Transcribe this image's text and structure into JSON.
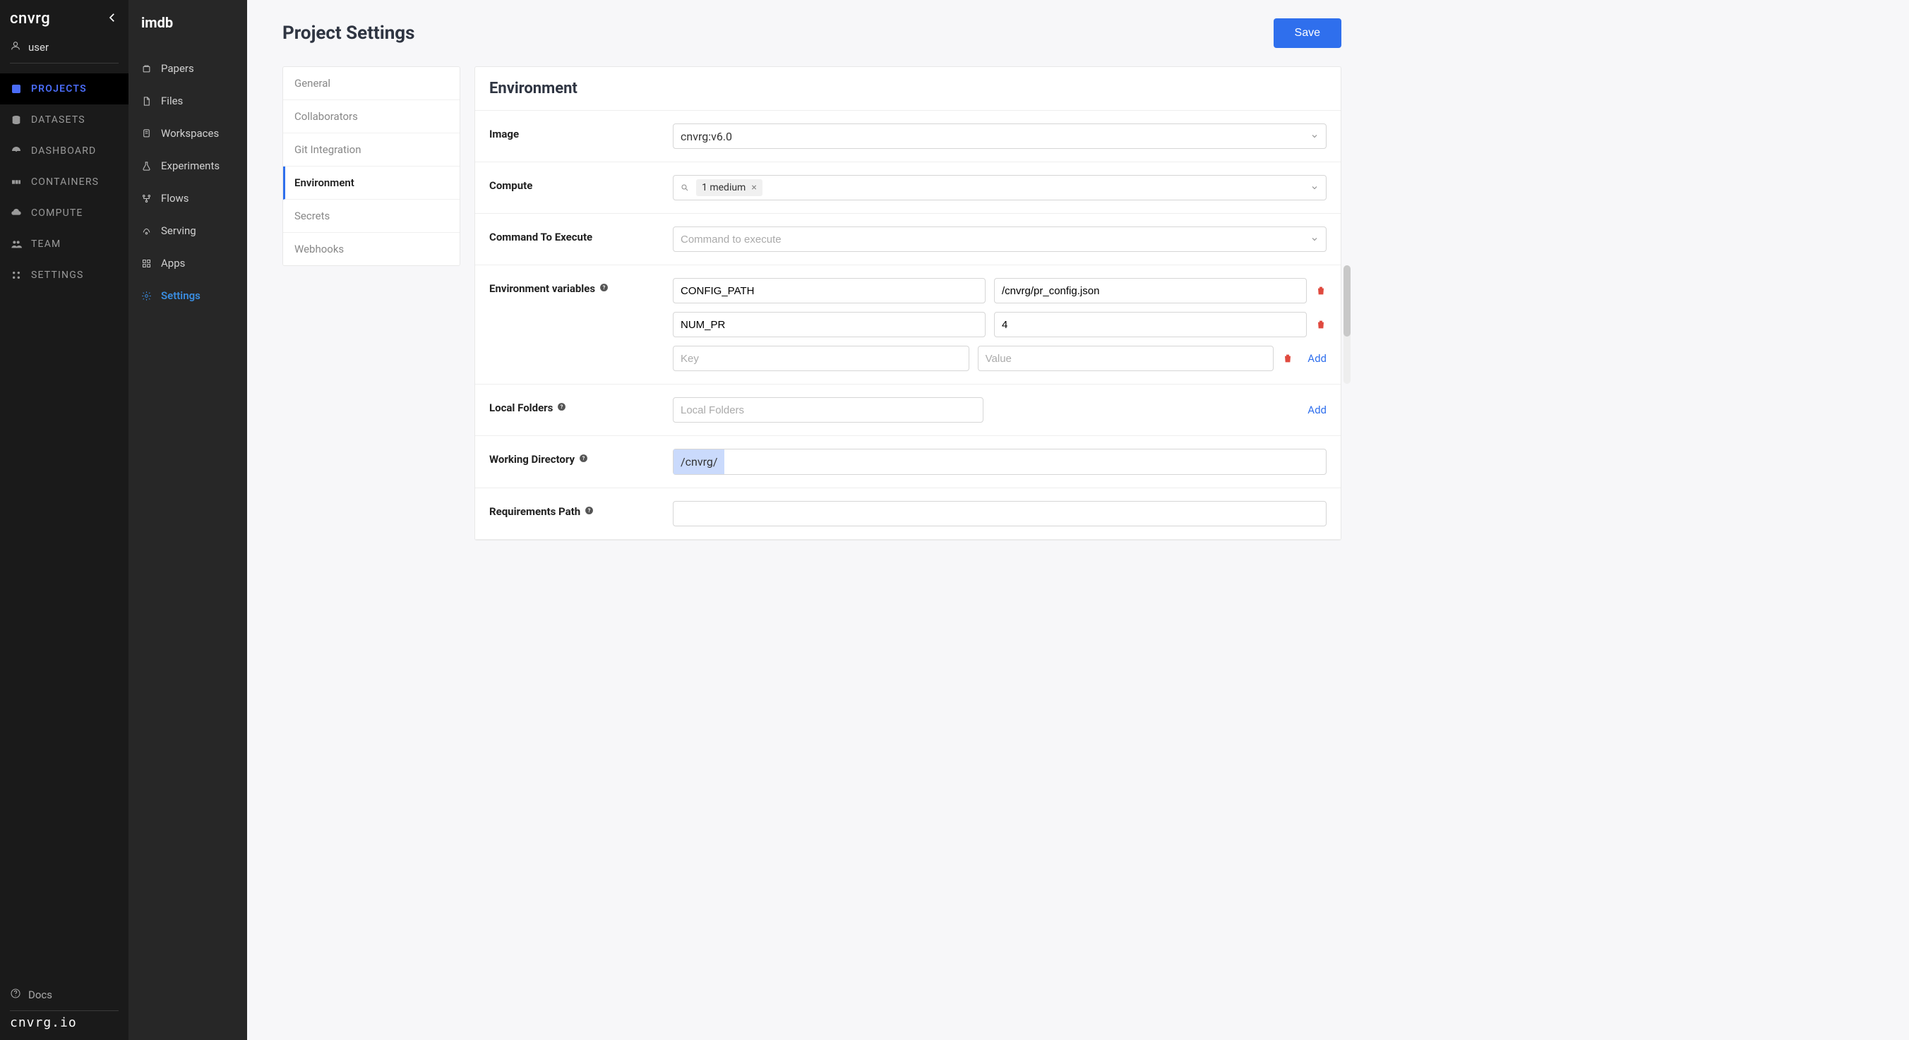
{
  "brand": {
    "name": "cnvrg",
    "footer": "cnvrg.io"
  },
  "user": {
    "name": "user"
  },
  "primary_nav": {
    "projects": "PROJECTS",
    "datasets": "DATASETS",
    "dashboard": "DASHBOARD",
    "containers": "CONTAINERS",
    "compute": "COMPUTE",
    "team": "TEAM",
    "settings": "SETTINGS"
  },
  "docs_label": "Docs",
  "project": {
    "title": "imdb"
  },
  "secondary_nav": {
    "papers": "Papers",
    "files": "Files",
    "workspaces": "Workspaces",
    "experiments": "Experiments",
    "flows": "Flows",
    "serving": "Serving",
    "apps": "Apps",
    "settings": "Settings"
  },
  "page": {
    "title": "Project Settings",
    "save_label": "Save"
  },
  "settings_tabs": {
    "general": "General",
    "collaborators": "Collaborators",
    "git": "Git Integration",
    "environment": "Environment",
    "secrets": "Secrets",
    "webhooks": "Webhooks"
  },
  "env_panel": {
    "title": "Environment",
    "image_label": "Image",
    "image_value": "cnvrg:v6.0",
    "compute_label": "Compute",
    "compute_chip": "1 medium",
    "command_label": "Command To Execute",
    "command_placeholder": "Command to execute",
    "envvars_label": "Environment variables",
    "envvars": [
      {
        "key": "CONFIG_PATH",
        "value": "/cnvrg/pr_config.json"
      },
      {
        "key": "NUM_PR",
        "value": "4"
      }
    ],
    "envvar_key_placeholder": "Key",
    "envvar_value_placeholder": "Value",
    "add_label": "Add",
    "local_folders_label": "Local Folders",
    "local_folders_placeholder": "Local Folders",
    "working_dir_label": "Working Directory",
    "working_dir_value": "/cnvrg/",
    "req_path_label": "Requirements Path"
  }
}
